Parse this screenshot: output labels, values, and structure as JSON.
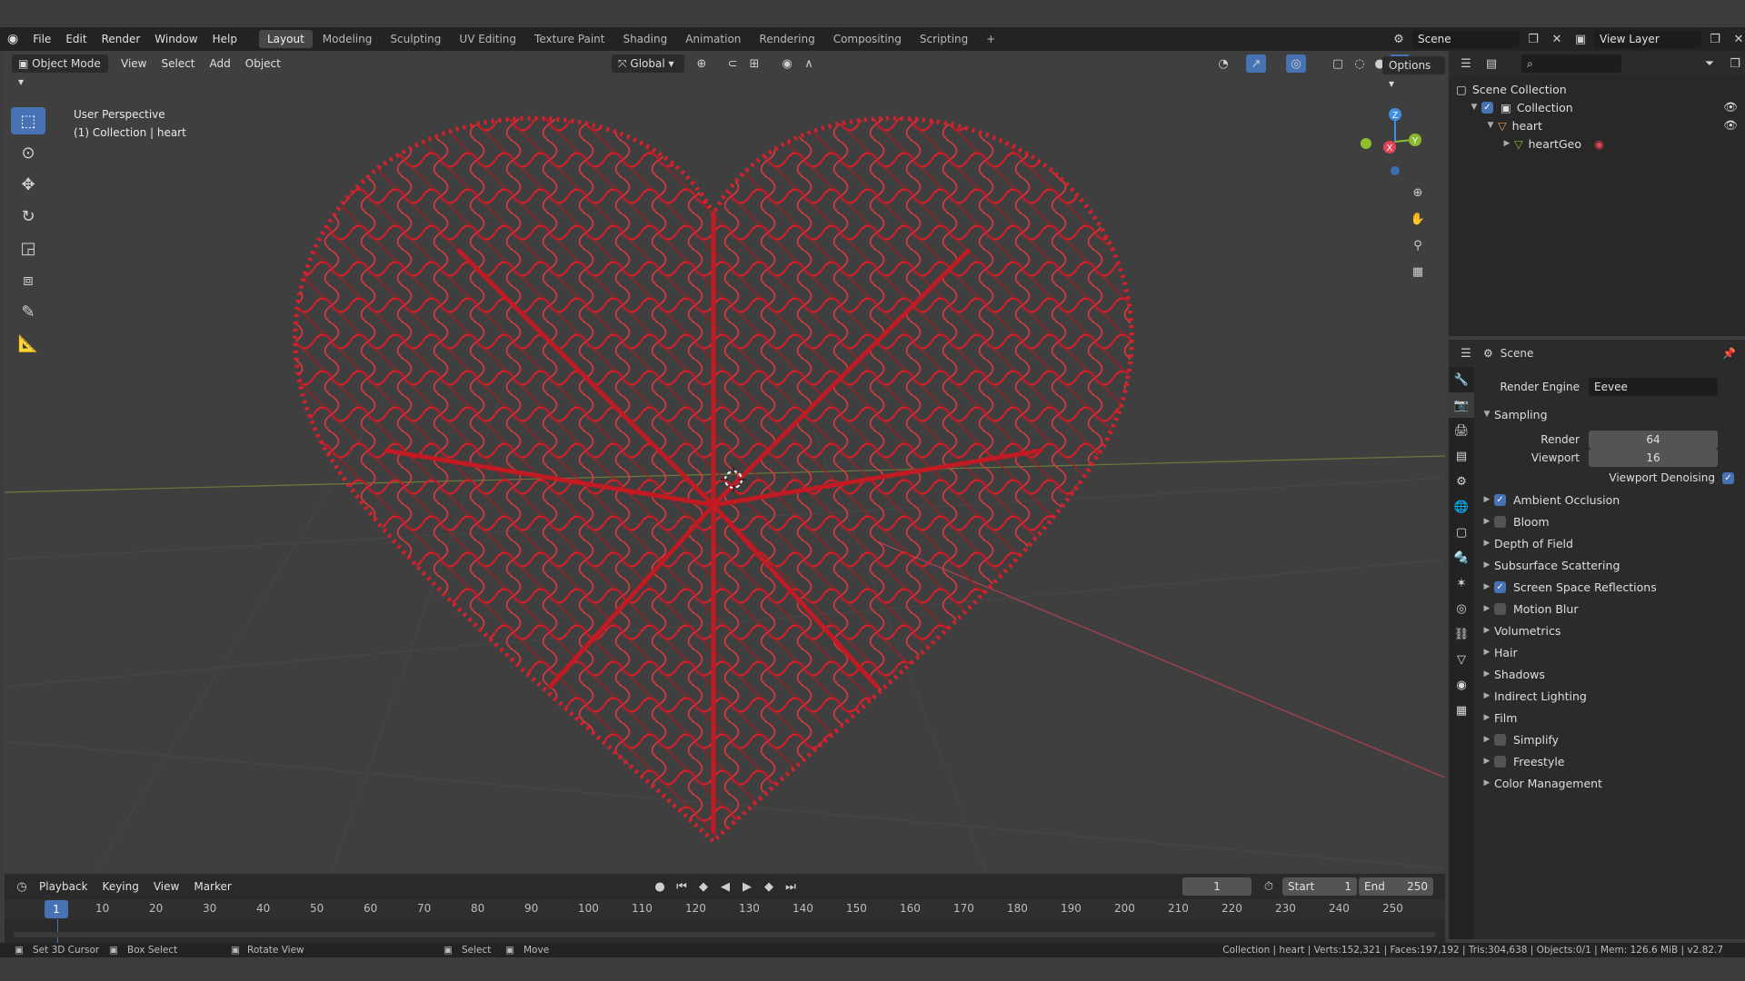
{
  "menus": [
    "File",
    "Edit",
    "Render",
    "Window",
    "Help"
  ],
  "workspaces": [
    "Layout",
    "Modeling",
    "Sculpting",
    "UV Editing",
    "Texture Paint",
    "Shading",
    "Animation",
    "Rendering",
    "Compositing",
    "Scripting"
  ],
  "active_workspace": "Layout",
  "scene_field": "Scene",
  "view_layer_field": "View Layer",
  "viewport": {
    "mode": "Object Mode",
    "menus": [
      "View",
      "Select",
      "Add",
      "Object"
    ],
    "transform_orientation": "Global",
    "options_label": "Options",
    "perspective_label": "User Perspective",
    "collection_label": "(1) Collection | heart",
    "gizmo_axes": {
      "z": "Z",
      "x": "X",
      "y": "Y"
    }
  },
  "outliner": {
    "root": "Scene Collection",
    "collection": "Collection",
    "object": "heart",
    "geometry": "heartGeo"
  },
  "properties": {
    "header": "Scene",
    "render_engine_label": "Render Engine",
    "render_engine_value": "Eevee",
    "sampling_label": "Sampling",
    "render_label": "Render",
    "render_value": "64",
    "viewport_label": "Viewport",
    "viewport_value": "16",
    "denoise_label": "Viewport Denoising",
    "denoise_checked": true,
    "sections": [
      {
        "label": "Ambient Occlusion",
        "checkbox": true,
        "checked": true
      },
      {
        "label": "Bloom",
        "checkbox": true,
        "checked": false
      },
      {
        "label": "Depth of Field",
        "checkbox": false
      },
      {
        "label": "Subsurface Scattering",
        "checkbox": false
      },
      {
        "label": "Screen Space Reflections",
        "checkbox": true,
        "checked": true
      },
      {
        "label": "Motion Blur",
        "checkbox": true,
        "checked": false
      },
      {
        "label": "Volumetrics",
        "checkbox": false
      },
      {
        "label": "Hair",
        "checkbox": false
      },
      {
        "label": "Shadows",
        "checkbox": false
      },
      {
        "label": "Indirect Lighting",
        "checkbox": false
      },
      {
        "label": "Film",
        "checkbox": false
      },
      {
        "label": "Simplify",
        "checkbox": true,
        "checked": false
      },
      {
        "label": "Freestyle",
        "checkbox": true,
        "checked": false
      },
      {
        "label": "Color Management",
        "checkbox": false
      }
    ]
  },
  "timeline": {
    "menus": [
      "Playback",
      "Keying",
      "View",
      "Marker"
    ],
    "current_frame": "1",
    "start_label": "Start",
    "start_value": "1",
    "end_label": "End",
    "end_value": "250",
    "ruler": [
      "10",
      "20",
      "30",
      "40",
      "50",
      "60",
      "70",
      "80",
      "90",
      "100",
      "110",
      "120",
      "130",
      "140",
      "150",
      "160",
      "170",
      "180",
      "190",
      "200",
      "210",
      "220",
      "230",
      "240",
      "250"
    ]
  },
  "statusbar": {
    "hints": [
      "Set 3D Cursor",
      "Box Select",
      "Rotate View",
      "Select",
      "Move"
    ],
    "stats": "Collection | heart | Verts:152,321 | Faces:197,192 | Tris:304,638 | Objects:0/1 | Mem: 126.6 MiB | v2.82.7"
  },
  "colors": {
    "accent": "#4772b3",
    "heart": "#d8202a",
    "x_axis": "#e0445a",
    "y_axis": "#8ab92e",
    "z_axis": "#3e8ee6"
  }
}
